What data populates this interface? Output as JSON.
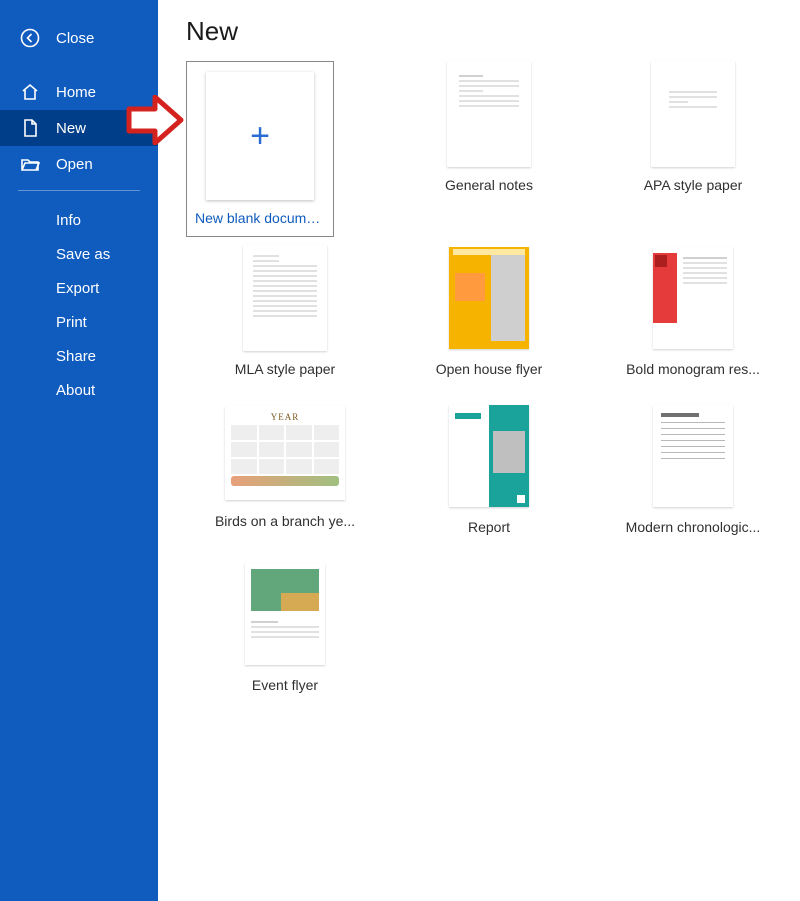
{
  "sidebar": {
    "close_label": "Close",
    "items": [
      {
        "label": "Home"
      },
      {
        "label": "New"
      },
      {
        "label": "Open"
      }
    ],
    "sub_items": [
      {
        "label": "Info"
      },
      {
        "label": "Save as"
      },
      {
        "label": "Export"
      },
      {
        "label": "Print"
      },
      {
        "label": "Share"
      },
      {
        "label": "About"
      }
    ]
  },
  "main": {
    "title": "New",
    "templates": [
      {
        "label": "New blank document"
      },
      {
        "label": "General notes"
      },
      {
        "label": "APA style paper"
      },
      {
        "label": "MLA style paper"
      },
      {
        "label": "Open house flyer"
      },
      {
        "label": "Bold monogram res..."
      },
      {
        "label": "Birds on a branch ye..."
      },
      {
        "label": "Report"
      },
      {
        "label": "Modern chronologic..."
      },
      {
        "label": "Event flyer"
      }
    ],
    "calendar_title": "YEAR"
  }
}
